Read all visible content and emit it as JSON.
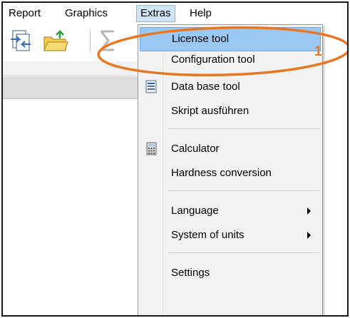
{
  "menubar": {
    "items": [
      {
        "label": "Report"
      },
      {
        "label": "Graphics"
      },
      {
        "label": "Extras"
      },
      {
        "label": "Help"
      }
    ]
  },
  "extras_menu": {
    "items": [
      {
        "label": "License tool",
        "highlighted": true
      },
      {
        "label": "Configuration tool"
      },
      {
        "label": "Data base tool",
        "icon": "database-icon"
      },
      {
        "label": "Skript ausführen"
      },
      {
        "label": "Calculator",
        "icon": "calculator-icon"
      },
      {
        "label": "Hardness conversion"
      },
      {
        "label": "Language",
        "submenu": true
      },
      {
        "label": "System of units",
        "submenu": true
      },
      {
        "label": "Settings"
      }
    ]
  },
  "annotation": {
    "number": "1",
    "color": "#e87722"
  },
  "colors": {
    "highlight": "#99c8f4",
    "menu_background": "#f2f2f2",
    "annotation": "#e87722"
  }
}
